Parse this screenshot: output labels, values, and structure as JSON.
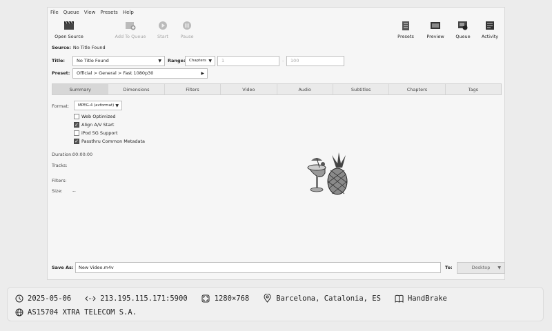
{
  "menu": [
    "File",
    "Queue",
    "View",
    "Presets",
    "Help"
  ],
  "toolbar": {
    "open_source": "Open Source",
    "add_to_queue": "Add To Queue",
    "start": "Start",
    "pause": "Pause",
    "presets": "Presets",
    "preview": "Preview",
    "queue": "Queue",
    "activity": "Activity"
  },
  "source": {
    "label": "Source:",
    "value": "No Title Found"
  },
  "title_row": {
    "label": "Title:",
    "value": "No Title Found",
    "range_label": "Range:",
    "range_mode": "Chapters",
    "range_start": "1",
    "range_end": "100"
  },
  "preset": {
    "label": "Preset:",
    "value": "Official > General > Fast 1080p30"
  },
  "tabs": [
    "Summary",
    "Dimensions",
    "Filters",
    "Video",
    "Audio",
    "Subtitles",
    "Chapters",
    "Tags"
  ],
  "summary": {
    "format_label": "Format:",
    "format_value": "MPEG-4 (avformat)",
    "options": [
      {
        "label": "Web Optimized",
        "checked": false
      },
      {
        "label": "Align A/V Start",
        "checked": true
      },
      {
        "label": "iPod 5G Support",
        "checked": false
      },
      {
        "label": "Passthru Common Metadata",
        "checked": true
      }
    ],
    "duration_label": "Duration:",
    "duration_value": "00:00:00",
    "tracks_label": "Tracks:",
    "filters_label": "Filters:",
    "size_label": "Size:",
    "size_value": "--"
  },
  "save": {
    "label": "Save As:",
    "value": "New Video.m4v",
    "to_label": "To:",
    "destination": "Desktop"
  },
  "info": {
    "date": "2025-05-06",
    "address": "213.195.115.171:5900",
    "resolution": "1280×768",
    "location": "Barcelona, Catalonia, ES",
    "app": "HandBrake",
    "asn": "AS15704 XTRA TELECOM S.A."
  }
}
